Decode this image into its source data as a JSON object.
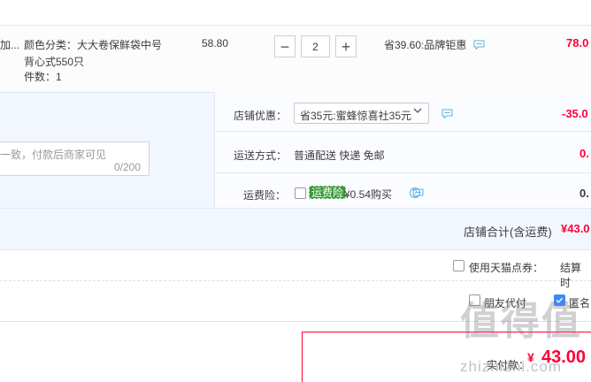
{
  "item": {
    "title_fragment": "加...",
    "sku": "颜色分类：大大卷保鲜袋中号 背心式550只",
    "qty_label": "件数：1",
    "price": "58.80",
    "quantity": "2",
    "minus": "−",
    "plus": "+",
    "saving": "省39.60:品牌钜惠",
    "total": "78.0"
  },
  "shop": {
    "message_placeholder": "一致，付款后商家可见",
    "message_count": "0/200",
    "discount_label": "店铺优惠：",
    "discount_selected": "省35元:蜜蜂惊喜社35元",
    "discount_value": "-35.0",
    "shipping_label": "运送方式：",
    "shipping_value": "普通配送 快递 免邮",
    "shipping_price": "0.",
    "insurance_label": "运费险：",
    "insurance_tag": "运费险",
    "insurance_price": "¥0.54购买",
    "insurance_value": "0.",
    "shop_total_label": "店铺合计(含运费)",
    "shop_total_value": "¥43.0"
  },
  "points": {
    "label": "使用天猫点券：",
    "note": "结算时"
  },
  "options": {
    "friend_pay": "朋友代付",
    "anonymous": "匿名"
  },
  "payment": {
    "label": "实付款：",
    "currency": "¥",
    "value": "43.00"
  },
  "watermark": {
    "logo": "值得值",
    "url": "zhizhizhi.com"
  },
  "colors": {
    "accent_red": "#ff0036",
    "panel_bg": "#f2f7ff",
    "checkbox_blue": "#3d8af7",
    "insurance_green": "#3c9a3c"
  }
}
